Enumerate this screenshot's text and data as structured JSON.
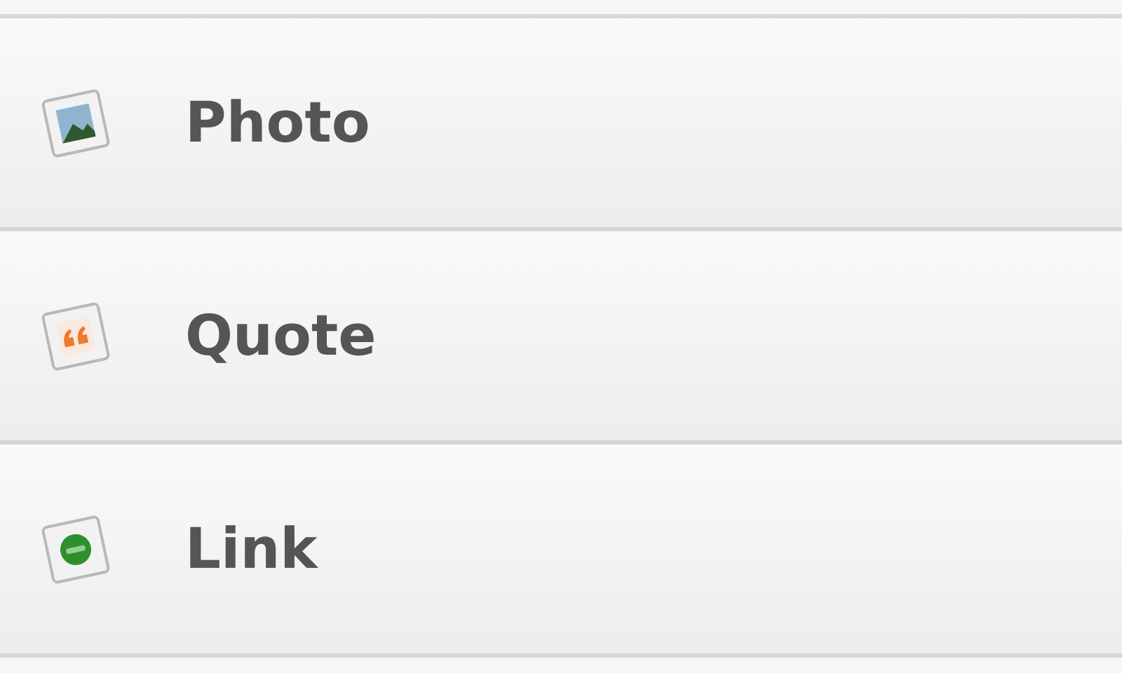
{
  "items": [
    {
      "kind": "photo",
      "label": "Photo"
    },
    {
      "kind": "quote",
      "label": "Quote"
    },
    {
      "kind": "link",
      "label": "Link"
    }
  ]
}
